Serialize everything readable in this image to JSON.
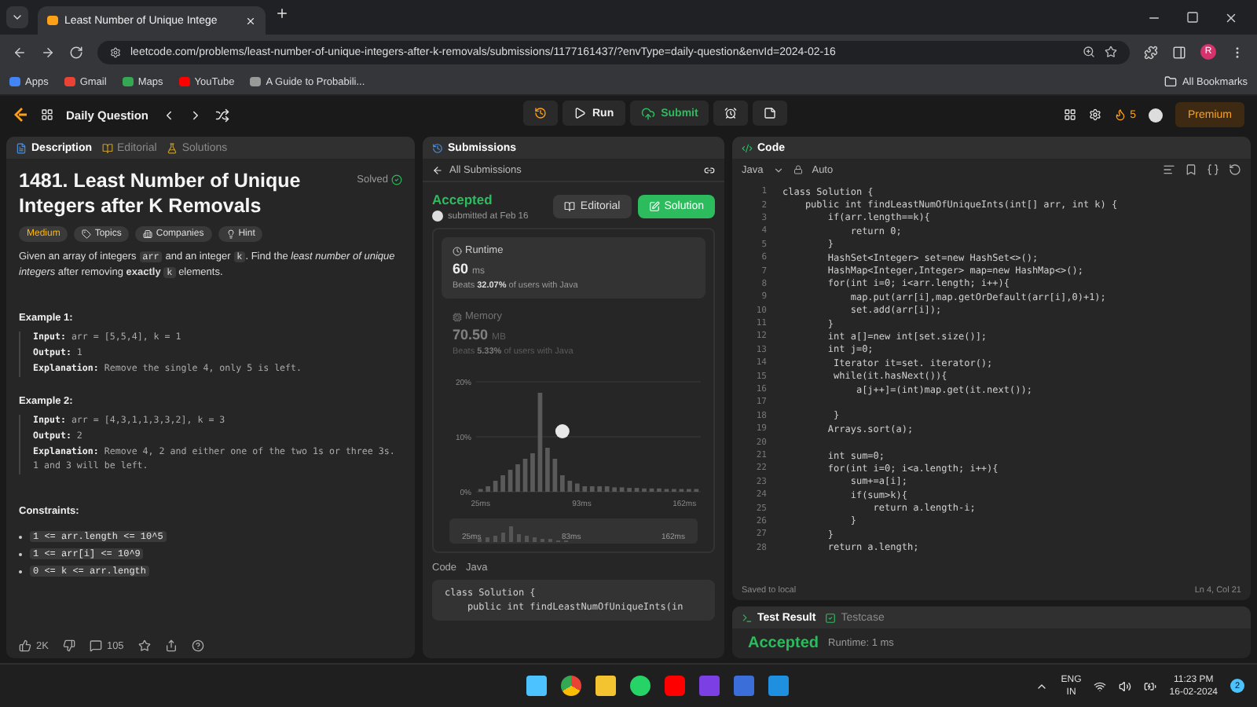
{
  "browser": {
    "tab_title": "Least Number of Unique Intege",
    "url": "leetcode.com/problems/least-number-of-unique-integers-after-k-removals/submissions/1177161437/?envType=daily-question&envId=2024-02-16",
    "profile": "R",
    "bookmarks": [
      "Apps",
      "Gmail",
      "Maps",
      "YouTube",
      "A Guide to Probabili..."
    ],
    "all_bookmarks": "All Bookmarks"
  },
  "nav": {
    "title": "Daily Question",
    "run": "Run",
    "submit": "Submit",
    "streak": "5",
    "premium": "Premium"
  },
  "description_panel": {
    "tabs": [
      {
        "label": "Description",
        "selected": true
      },
      {
        "label": "Editorial",
        "selected": false
      },
      {
        "label": "Solutions",
        "selected": false
      }
    ],
    "title": "1481. Least Number of Unique Integers after K Removals",
    "status": "Solved",
    "difficulty": "Medium",
    "tags": [
      "Topics",
      "Companies",
      "Hint"
    ],
    "statement": [
      {
        "kind": "text",
        "text": "Given an array of integers "
      },
      {
        "kind": "code",
        "text": "arr"
      },
      {
        "kind": "text",
        "text": " and an integer "
      },
      {
        "kind": "code",
        "text": "k"
      },
      {
        "kind": "text",
        "text": ". Find the *least number of unique integers* after removing **exactly** "
      },
      {
        "kind": "code",
        "text": "k"
      },
      {
        "kind": "text",
        "text": " elements."
      }
    ],
    "examples": [
      {
        "heading": "Example 1:",
        "lines": [
          "**Input:** arr = [5,5,4], k = 1",
          "**Output:** 1",
          "**Explanation:** Remove the single 4, only 5 is left."
        ]
      },
      {
        "heading": "Example 2:",
        "lines": [
          "**Input:** arr = [4,3,1,1,3,3,2], k = 3",
          "**Output:** 2",
          "**Explanation:** Remove 4, 2 and either one of the two 1s or three 3s. 1 and 3 will be left."
        ]
      }
    ],
    "constraints_heading": "Constraints:",
    "constraints": [
      "1 <= arr.length <= 10^5",
      "1 <= arr[i] <= 10^9",
      "0 <= k <= arr.length"
    ],
    "likes": "2K",
    "comments": "105"
  },
  "submission_panel": {
    "tab": "Submissions",
    "back": "All Submissions",
    "status": "Accepted",
    "submitted": "submitted at Feb 16",
    "buttons": [
      {
        "label": "Editorial",
        "kind": "secondary"
      },
      {
        "label": "Solution",
        "kind": "primary"
      }
    ],
    "metrics": [
      {
        "label": "Runtime",
        "value": "60",
        "unit": "ms",
        "beats": "Beats **32.07%** of users with Java",
        "selected": true
      },
      {
        "label": "Memory",
        "value": "70.50",
        "unit": "MB",
        "beats": "Beats **5.33%** of users with Java",
        "selected": false
      }
    ],
    "chart_data": {
      "type": "bar",
      "x": [
        25,
        30,
        35,
        40,
        45,
        50,
        55,
        60,
        65,
        70,
        75,
        80,
        85,
        90,
        95,
        100,
        105,
        110,
        115,
        120,
        125,
        130,
        135,
        140,
        145,
        150,
        155,
        160,
        165,
        170
      ],
      "series": [
        {
          "color": "#5a5a5a",
          "values": [
            0.5,
            1,
            2,
            3,
            4,
            5,
            6,
            7,
            18,
            8,
            6,
            3,
            2,
            1.5,
            1,
            1,
            1,
            1,
            0.8,
            0.8,
            0.7,
            0.7,
            0.6,
            0.6,
            0.6,
            0.5,
            0.5,
            0.5,
            0.5,
            0.5
          ]
        }
      ],
      "xlim": [
        22,
        173
      ],
      "ylim": [
        0,
        20
      ],
      "yticks": [
        {
          "value": 0,
          "label": "0%"
        },
        {
          "value": 10,
          "label": "10%"
        },
        {
          "value": 20,
          "label": "20%"
        }
      ],
      "xticks": [
        {
          "value": 25,
          "label": "25ms"
        },
        {
          "value": 93,
          "label": "93ms"
        },
        {
          "value": 162,
          "label": "162ms"
        }
      ]
    },
    "overview_labels": [
      "25ms",
      "83ms",
      "162ms"
    ],
    "code_header": {
      "label": "Code",
      "language": "Java"
    },
    "code_preview": [
      "class Solution {",
      "    public int findLeastNumOfUniqueInts(in"
    ]
  },
  "editor": {
    "tab": "Code",
    "language": "Java",
    "mode": "Auto",
    "lines": [
      {
        "number": "1",
        "text": "class Solution {"
      },
      {
        "number": "2",
        "text": "    public int findLeastNumOfUniqueInts(int[] arr, int k) {"
      },
      {
        "number": "3",
        "text": "        if(arr.length==k){"
      },
      {
        "number": "4",
        "text": "            return 0;"
      },
      {
        "number": "5",
        "text": "        }"
      },
      {
        "number": "6",
        "text": "        HashSet<Integer> set=new HashSet<>();"
      },
      {
        "number": "7",
        "text": "        HashMap<Integer,Integer> map=new HashMap<>();"
      },
      {
        "number": "8",
        "text": "        for(int i=0; i<arr.length; i++){"
      },
      {
        "number": "9",
        "text": "            map.put(arr[i],map.getOrDefault(arr[i],0)+1);"
      },
      {
        "number": "10",
        "text": "            set.add(arr[i]);"
      },
      {
        "number": "11",
        "text": "        }"
      },
      {
        "number": "12",
        "text": "        int a[]=new int[set.size()];"
      },
      {
        "number": "13",
        "text": "        int j=0;"
      },
      {
        "number": "14",
        "text": "         Iterator it=set. iterator();"
      },
      {
        "number": "15",
        "text": "         while(it.hasNext()){"
      },
      {
        "number": "16",
        "text": "             a[j++]=(int)map.get(it.next());"
      },
      {
        "number": "17"
      },
      {
        "number": "18",
        "text": "         }"
      },
      {
        "number": "19",
        "text": "        Arrays.sort(a);"
      },
      {
        "number": "20"
      },
      {
        "number": "21",
        "text": "        int sum=0;"
      },
      {
        "number": "22",
        "text": "        for(int i=0; i<a.length; i++){"
      },
      {
        "number": "23",
        "text": "            sum+=a[i];"
      },
      {
        "number": "24",
        "text": "            if(sum>k){"
      },
      {
        "number": "25",
        "text": "                return a.length-i;"
      },
      {
        "number": "26",
        "text": "            }"
      },
      {
        "number": "27",
        "text": "        }"
      },
      {
        "number": "28",
        "text": "        return a.length;"
      }
    ],
    "status": "Saved to local",
    "cursor": "Ln 4, Col 21"
  },
  "console": {
    "tabs": [
      {
        "label": "Test Result",
        "selected": true
      },
      {
        "label": "Testcase",
        "selected": false
      }
    ],
    "result": "Accepted",
    "runtime": "Runtime: 1 ms"
  },
  "taskbar": {
    "language": "ENG",
    "region": "IN",
    "time": "11:23 PM",
    "date": "16-02-2024",
    "notifications": "2"
  }
}
